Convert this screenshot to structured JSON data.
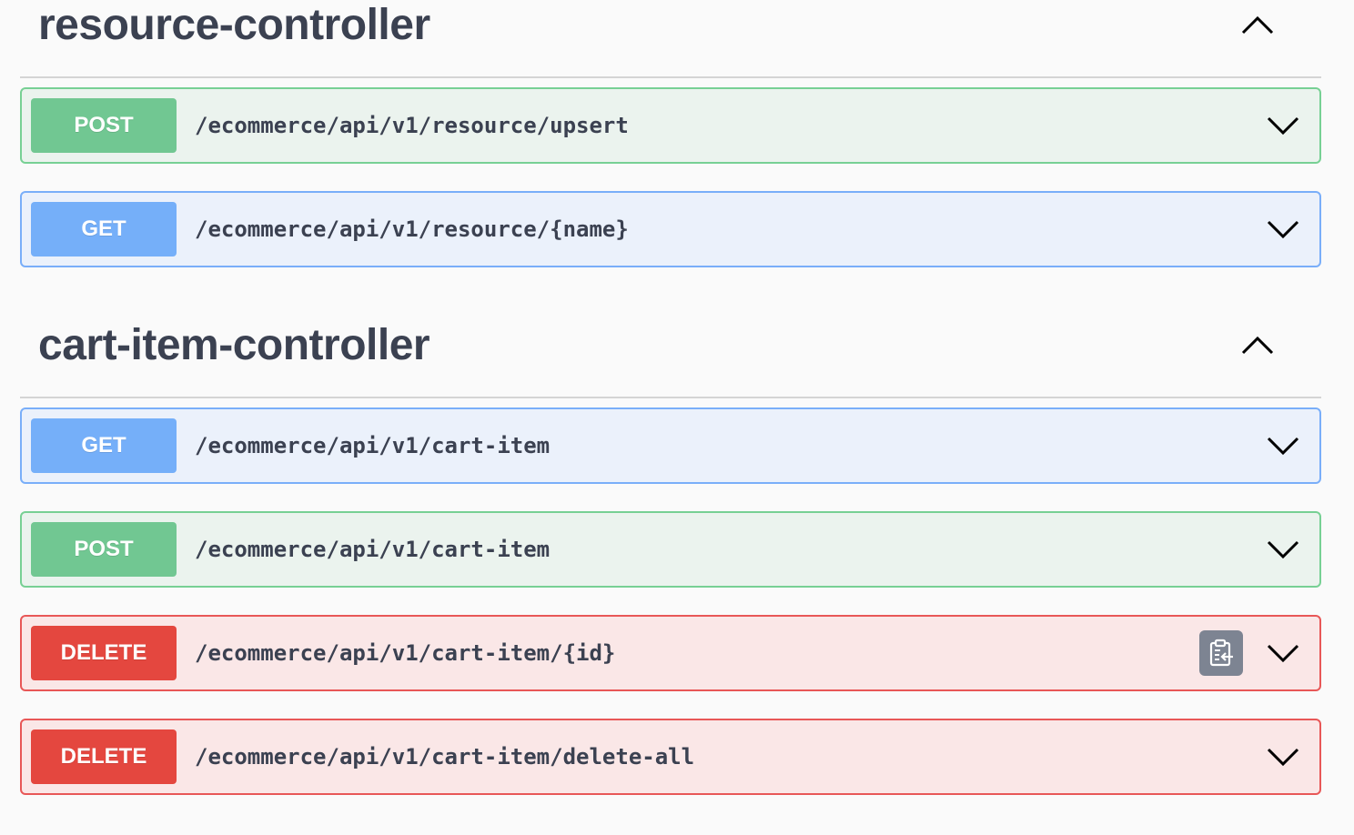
{
  "sections": [
    {
      "title": "resource-controller",
      "operations": [
        {
          "method": "POST",
          "path": "/ecommerce/api/v1/resource/upsert"
        },
        {
          "method": "GET",
          "path": "/ecommerce/api/v1/resource/{name}"
        }
      ]
    },
    {
      "title": "cart-item-controller",
      "operations": [
        {
          "method": "GET",
          "path": "/ecommerce/api/v1/cart-item"
        },
        {
          "method": "POST",
          "path": "/ecommerce/api/v1/cart-item"
        },
        {
          "method": "DELETE",
          "path": "/ecommerce/api/v1/cart-item/{id}",
          "copy_icon": "copy-to-clipboard-icon"
        },
        {
          "method": "DELETE",
          "path": "/ecommerce/api/v1/cart-item/delete-all"
        }
      ]
    }
  ],
  "colors": {
    "post_badge": "#71c792",
    "get_badge": "#75aff9",
    "delete_badge": "#e4473f",
    "title_text": "#3b4151"
  },
  "icons": {
    "collapse": "chevron-up-icon",
    "expand": "chevron-down-icon",
    "copy": "copy-to-clipboard-icon"
  }
}
